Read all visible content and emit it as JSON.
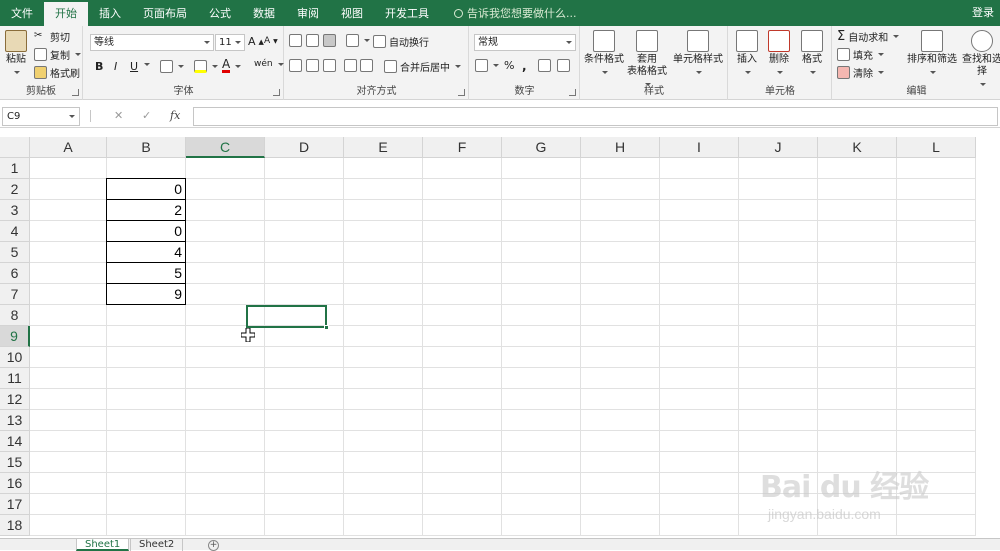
{
  "menubar": {
    "tabs": [
      "文件",
      "开始",
      "插入",
      "页面布局",
      "公式",
      "数据",
      "审阅",
      "视图",
      "开发工具"
    ],
    "active_tab": "开始",
    "tellme": "告诉我您想要做什么...",
    "login": "登录",
    "accent": "#217346"
  },
  "ribbon": {
    "clipboard": {
      "label": "剪贴板",
      "paste": "粘贴",
      "cut": "剪切",
      "copy": "复制",
      "format_painter": "格式刷"
    },
    "font": {
      "label": "字体",
      "font_name": "等线",
      "font_size": "11",
      "bold": "B",
      "italic": "I",
      "underline": "U",
      "grow": "A",
      "shrink": "A",
      "font_color_glyph": "A",
      "phonetic": "wén"
    },
    "alignment": {
      "label": "对齐方式",
      "wrap": "自动换行",
      "merge": "合并后居中"
    },
    "number": {
      "label": "数字",
      "format": "常规",
      "percent": "%",
      "comma": ","
    },
    "styles": {
      "label": "样式",
      "conditional": "条件格式",
      "table_line1": "套用",
      "table_line2": "表格格式",
      "cell_styles": "单元格样式"
    },
    "cells": {
      "label": "单元格",
      "insert": "插入",
      "delete": "删除",
      "format": "格式"
    },
    "editing": {
      "label": "编辑",
      "autosum": "自动求和",
      "fill": "填充",
      "clear": "清除",
      "sort": "排序和筛选",
      "find": "查找和选择"
    }
  },
  "formulabar": {
    "namebox": "C9",
    "fx": "fx",
    "cancel": "✕",
    "enter": "✓",
    "value": ""
  },
  "grid": {
    "columns": [
      "A",
      "B",
      "C",
      "D",
      "E",
      "F",
      "G",
      "H",
      "I",
      "J",
      "K",
      "L"
    ],
    "rows": [
      "1",
      "2",
      "3",
      "4",
      "5",
      "6",
      "7",
      "8",
      "9",
      "10",
      "11",
      "12",
      "13",
      "14",
      "15",
      "16",
      "17",
      "18"
    ],
    "selected_column": "C",
    "selected_row": "9",
    "cells_B": [
      "",
      "0",
      "2",
      "0",
      "4",
      "5",
      "9"
    ]
  },
  "sheets": {
    "tabs": [
      "Sheet1",
      "Sheet2"
    ],
    "active": "Sheet1",
    "add": "+"
  },
  "watermark": {
    "brand": "Bai du 经验",
    "url": "jingyan.baidu.com"
  }
}
